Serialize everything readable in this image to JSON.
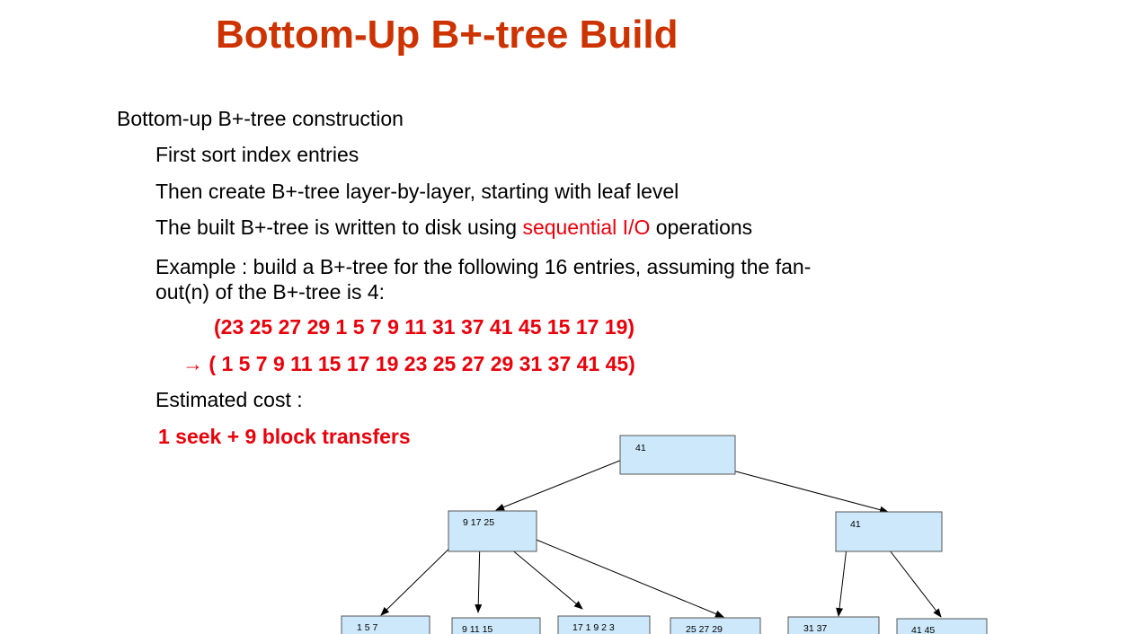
{
  "title": "Bottom-Up B+-tree Build",
  "bullets": {
    "main": "Bottom-up B+-tree construction",
    "sort": "First  sort index entries",
    "create": "Then create B+-tree layer-by-layer, starting with leaf level",
    "disk_prefix": "The built B+-tree is written to disk using ",
    "disk_highlight": "sequential I/O",
    "disk_suffix": " operations",
    "example_line1": "Example : build a B+-tree for the following 16 entries, assuming the fan-",
    "example_line2": "out(n) of the B+-tree is 4:",
    "unsorted": "(23  25 27 29  1  5  7  9  11 31  37  41  45  15 17  19)",
    "sorted_arrow": "→",
    "sorted": " ( 1   5   7  9  11 15 17  19 23  25 27 29 31  37  41  45)",
    "cost_label": "Estimated cost :",
    "cost_value": "1 seek + 9 block transfers"
  },
  "tree": {
    "root": {
      "keys": "41"
    },
    "internal": [
      {
        "keys": "9  17 25"
      },
      {
        "keys": "41"
      }
    ],
    "leaves": [
      {
        "keys": "1    5    7"
      },
      {
        "keys": "9   11   15"
      },
      {
        "keys": "17  1 9  2 3"
      },
      {
        "keys": "25  27   29"
      },
      {
        "keys": "31    37"
      },
      {
        "keys": "41  45"
      }
    ],
    "node_fill": "#cde8fa",
    "node_stroke": "#555555"
  }
}
